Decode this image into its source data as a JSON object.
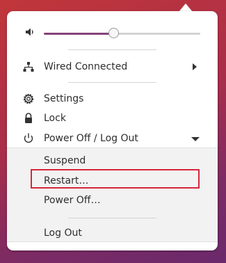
{
  "menu": {
    "volume": {
      "icon": "volume-icon",
      "level_percent": 45
    },
    "network": {
      "label": "Wired Connected",
      "icon": "network-wired-icon"
    },
    "settings": {
      "label": "Settings",
      "icon": "gear-icon"
    },
    "lock": {
      "label": "Lock",
      "icon": "lock-icon"
    },
    "power": {
      "label": "Power Off / Log Out",
      "icon": "power-icon",
      "expanded": true,
      "items": [
        {
          "label": "Suspend"
        },
        {
          "label": "Restart…",
          "highlighted": true
        },
        {
          "label": "Power Off…"
        },
        {
          "label": "Log Out"
        }
      ]
    }
  },
  "colors": {
    "slider_fill": "#86437a",
    "highlight_border": "#d7263d",
    "menu_background": "#ffffff",
    "submenu_background": "#f2f2f2"
  }
}
